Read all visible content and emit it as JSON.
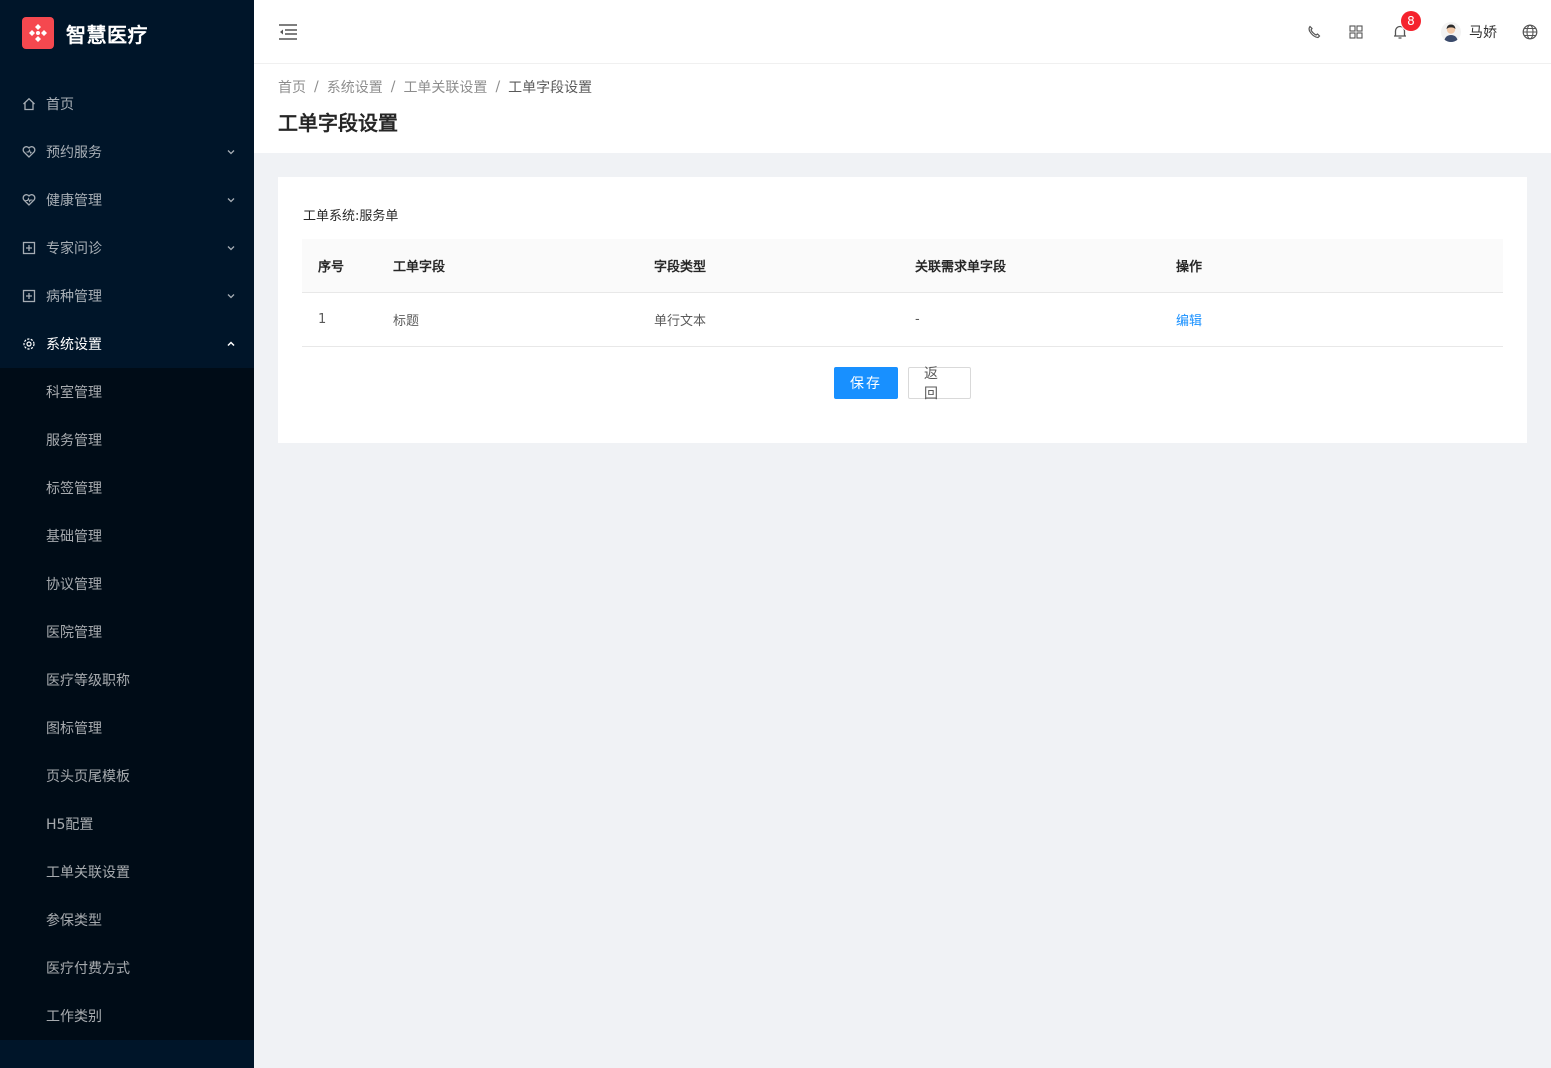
{
  "app": {
    "title": "智慧医疗"
  },
  "sidebar": {
    "items": [
      {
        "label": "首页",
        "icon": "home-icon",
        "has_children": false
      },
      {
        "label": "预约服务",
        "icon": "heart-service-icon",
        "has_children": true
      },
      {
        "label": "健康管理",
        "icon": "heart-pulse-icon",
        "has_children": true
      },
      {
        "label": "专家问诊",
        "icon": "plus-square-icon",
        "has_children": true
      },
      {
        "label": "病种管理",
        "icon": "plus-square-icon",
        "has_children": true
      },
      {
        "label": "系统设置",
        "icon": "gear-icon",
        "has_children": true,
        "expanded": true
      }
    ],
    "sub_items": [
      "科室管理",
      "服务管理",
      "标签管理",
      "基础管理",
      "协议管理",
      "医院管理",
      "医疗等级职称",
      "图标管理",
      "页头页尾模板",
      "H5配置",
      "工单关联设置",
      "参保类型",
      "医疗付费方式",
      "工作类别"
    ]
  },
  "header": {
    "notification_count": "8",
    "username": "马娇"
  },
  "breadcrumb": [
    "首页",
    "系统设置",
    "工单关联设置",
    "工单字段设置"
  ],
  "page_title": "工单字段设置",
  "system": {
    "label": "工单系统:",
    "value": "服务单"
  },
  "table": {
    "columns": [
      "序号",
      "工单字段",
      "字段类型",
      "关联需求单字段",
      "操作"
    ],
    "rows": [
      {
        "index": "1",
        "field": "标题",
        "type": "单行文本",
        "linked": "-",
        "action": "编辑"
      }
    ]
  },
  "buttons": {
    "save": "保存",
    "back": "返回"
  },
  "colors": {
    "sidebar_bg": "#001529",
    "submenu_bg": "#000c17",
    "primary": "#1890ff",
    "badge": "#f5222d",
    "logo": "#f5484f"
  }
}
